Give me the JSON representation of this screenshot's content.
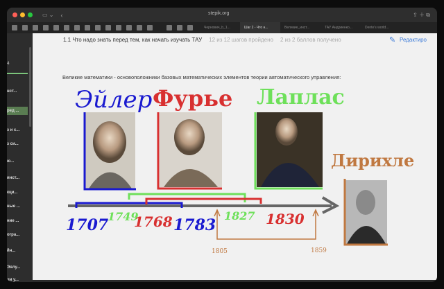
{
  "browser": {
    "url": "stepik.org",
    "tabs": [
      "Чернович_b_1...",
      "Шаг 2 - Что н...",
      "Великие_инст...",
      "ТАУ Андриенко...",
      "Dente's world..."
    ]
  },
  "sidebar": {
    "top": "4",
    "items": [
      "нст...",
      "ред ...",
      "з и с...",
      "з си...",
      "ю...",
      "инст...",
      "кци...",
      "ные ...",
      "ние ...",
      "огра...",
      "йн...",
      "Эялу...",
      "ии у..."
    ]
  },
  "header": {
    "title": "1.1 Что надо знать перед тем, как начать изучать ТАУ",
    "steps": "12 из 12 шагов пройдено",
    "points": "2 из 2 баллов  получено",
    "edit": "Редактиро"
  },
  "intro": "Великие математики - основоположники базовых математических элементов теории автоматического управления:",
  "names": {
    "euler": "Эйлер",
    "fourier": "Фурье",
    "laplace": "Лаплас",
    "dirichlet": "Дирихле"
  },
  "years": {
    "euler_birth": "1707",
    "euler_death": "1783",
    "fourier_birth": "1768",
    "fourier_death": "1830",
    "laplace_birth": "1749",
    "laplace_death": "1827",
    "dirichlet_birth": "1805",
    "dirichlet_death": "1859"
  },
  "colors": {
    "euler": "#1a1ad0",
    "fourier": "#d83030",
    "laplace": "#6ee05a",
    "dirichlet": "#c07840"
  }
}
